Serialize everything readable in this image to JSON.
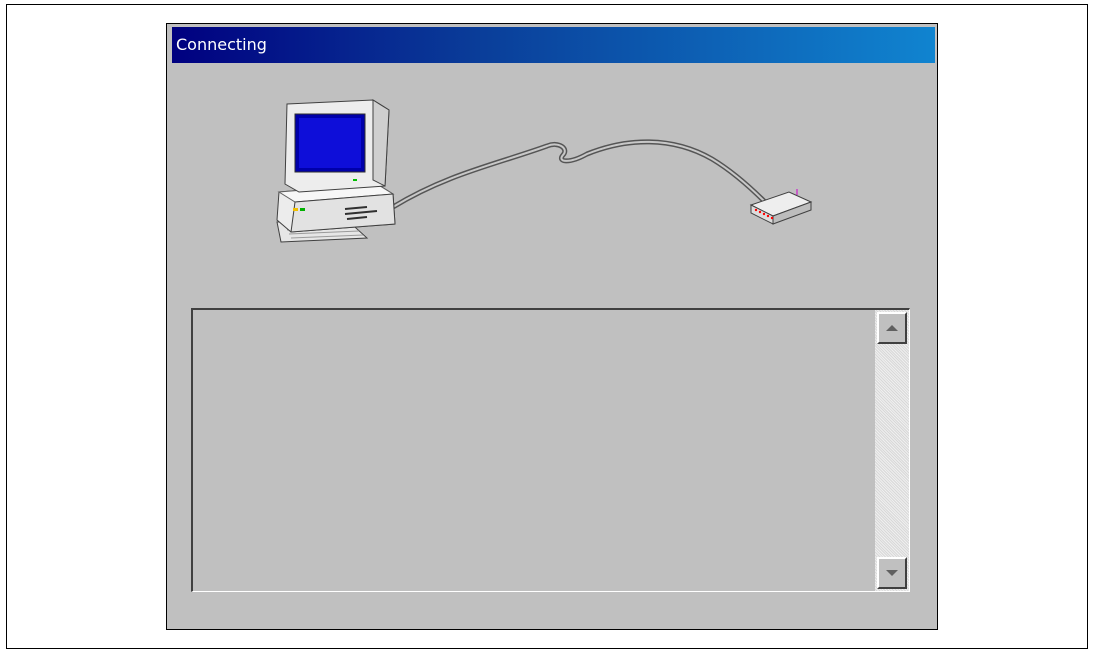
{
  "window": {
    "title": "Connecting"
  },
  "illustration": {
    "left_icon": "computer-icon",
    "right_icon": "modem-icon",
    "cable": "cable"
  },
  "log": {
    "text": ""
  },
  "scrollbar": {
    "up_icon": "arrow-up-icon",
    "down_icon": "arrow-down-icon"
  },
  "colors": {
    "title_bar_start": "#000080",
    "title_bar_end": "#1084d0",
    "dialog_face": "#c0c0c0",
    "title_text": "#ffffff"
  }
}
